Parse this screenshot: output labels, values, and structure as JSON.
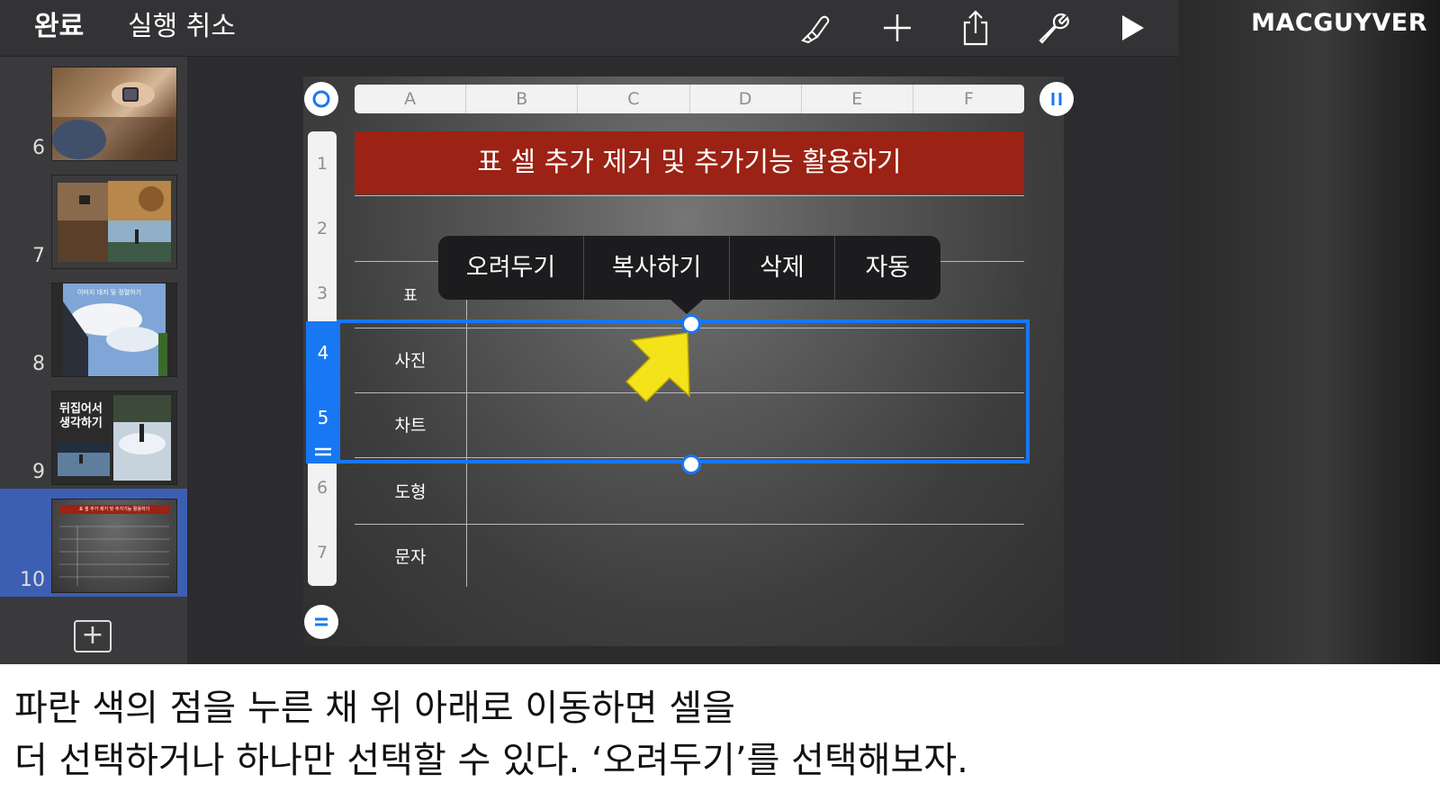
{
  "toolbar": {
    "done_label": "완료",
    "undo_label": "실행 취소",
    "icons": [
      "format-brush-icon",
      "add-icon",
      "share-icon",
      "wrench-icon",
      "play-icon"
    ]
  },
  "brand": "MACGUYVER",
  "sidebar": {
    "slides": [
      {
        "number": "6"
      },
      {
        "number": "7"
      },
      {
        "number": "8",
        "thumb_text": "이미지 대지 및 정렬하기"
      },
      {
        "number": "9",
        "thumb_text": "뒤집어서\n생각하기"
      },
      {
        "number": "10",
        "selected": true,
        "thumb_text": "표 셀 추가 제거 및 추가기능 활용하기"
      }
    ]
  },
  "table": {
    "columns": [
      "A",
      "B",
      "C",
      "D",
      "E",
      "F"
    ],
    "row_numbers": [
      "1",
      "2",
      "3",
      "4",
      "5",
      "6",
      "7"
    ],
    "title": "표 셀 추가 제거 및 추가기능 활용하기",
    "row_labels": [
      "표",
      "사진",
      "차트",
      "도형",
      "문자"
    ],
    "selected_rows": [
      "4",
      "5"
    ],
    "selection_color": "#1877f2",
    "banner_color": "#9b2214"
  },
  "context_menu": {
    "items": [
      "오려두기",
      "복사하기",
      "삭제",
      "자동"
    ]
  },
  "caption": {
    "line1": "파란 색의 점을 누른 채 위 아래로 이동하면 셀을",
    "line2": "더 선택하거나 하나만 선택할 수 있다. ‘오려두기’를 선택해보자."
  }
}
